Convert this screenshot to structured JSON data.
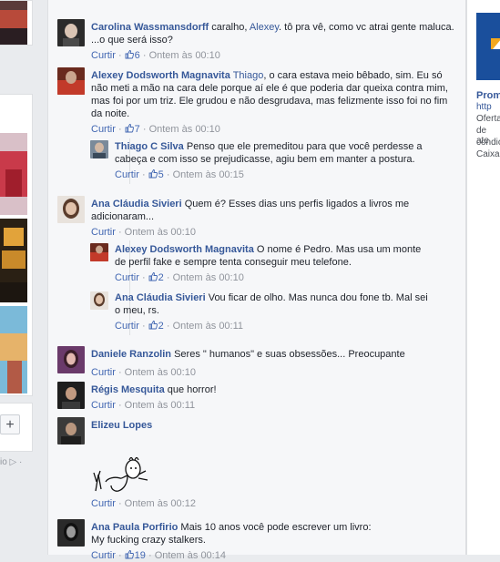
{
  "left": {
    "add_label": "+",
    "footer_text": "io ▷ ·"
  },
  "comments": [
    {
      "author": "Carolina Wassmansdorff",
      "text_before": " caralho, ",
      "mention": "Alexey",
      "text_after": ". tô pra vê, como vc atrai gente maluca. ...o que será isso?",
      "reply": "Curtir",
      "likes": "6",
      "time": "Ontem às 00:10"
    },
    {
      "author": "Alexey Dodsworth Magnavita",
      "mention": "Thiago",
      "text_after": ", o cara estava meio bêbado, sim. Eu só não meti a mão na cara dele porque aí ele é que poderia dar queixa contra mim, mas foi por um triz. Ele grudou e não desgrudava, mas felizmente isso foi no fim da noite.",
      "reply": "Curtir",
      "likes": "7",
      "time": "Ontem às 00:10"
    },
    {
      "author": "Thiago C Silva",
      "text": " Penso que ele premeditou para que você perdesse a cabeça e com isso se prejudicasse, agiu bem em manter a postura.",
      "reply": "Curtir",
      "likes": "5",
      "time": "Ontem às 00:15"
    },
    {
      "author": "Ana Cláudia Sivieri",
      "text": " Quem é? Esses dias uns perfis ligados a livros me adicionaram...",
      "reply": "Curtir",
      "time": "Ontem às 00:10"
    },
    {
      "author": "Alexey Dodsworth Magnavita",
      "text": " O nome é Pedro. Mas usa um monte de perfil fake e sempre tenta conseguir meu telefone.",
      "reply": "Curtir",
      "likes": "2",
      "time": "Ontem às 00:10"
    },
    {
      "author": "Ana Cláudia Sivieri",
      "text": " Vou ficar de olho. Mas nunca dou fone tb. Mal sei o meu, rs.",
      "reply": "Curtir",
      "likes": "2",
      "time": "Ontem às 00:11"
    },
    {
      "author": "Daniele Ranzolin",
      "text": " Seres \" humanos\" e suas obsessões... Preocupante",
      "reply": "Curtir",
      "time": "Ontem às 00:10"
    },
    {
      "author": "Régis Mesquita",
      "text": " que horror!",
      "reply": "Curtir",
      "time": "Ontem às 00:11"
    },
    {
      "author": "Elizeu Lopes",
      "reply": "Curtir",
      "time": "Ontem às 00:12"
    },
    {
      "author": "Ana Paula Porfirio",
      "text": " Mais 10 anos você pode escrever um livro: My fucking crazy stalkers.",
      "reply": "Curtir",
      "likes": "19",
      "time": "Ontem às 00:14"
    }
  ],
  "right": {
    "title": "Prom",
    "url": "http",
    "lines": [
      "Oferta",
      "de ate",
      "condic",
      "Caixa"
    ]
  },
  "colors": {
    "link": "#365899",
    "meta": "#90949c",
    "panel": "#f6f7f9",
    "page": "#e9ebee"
  }
}
